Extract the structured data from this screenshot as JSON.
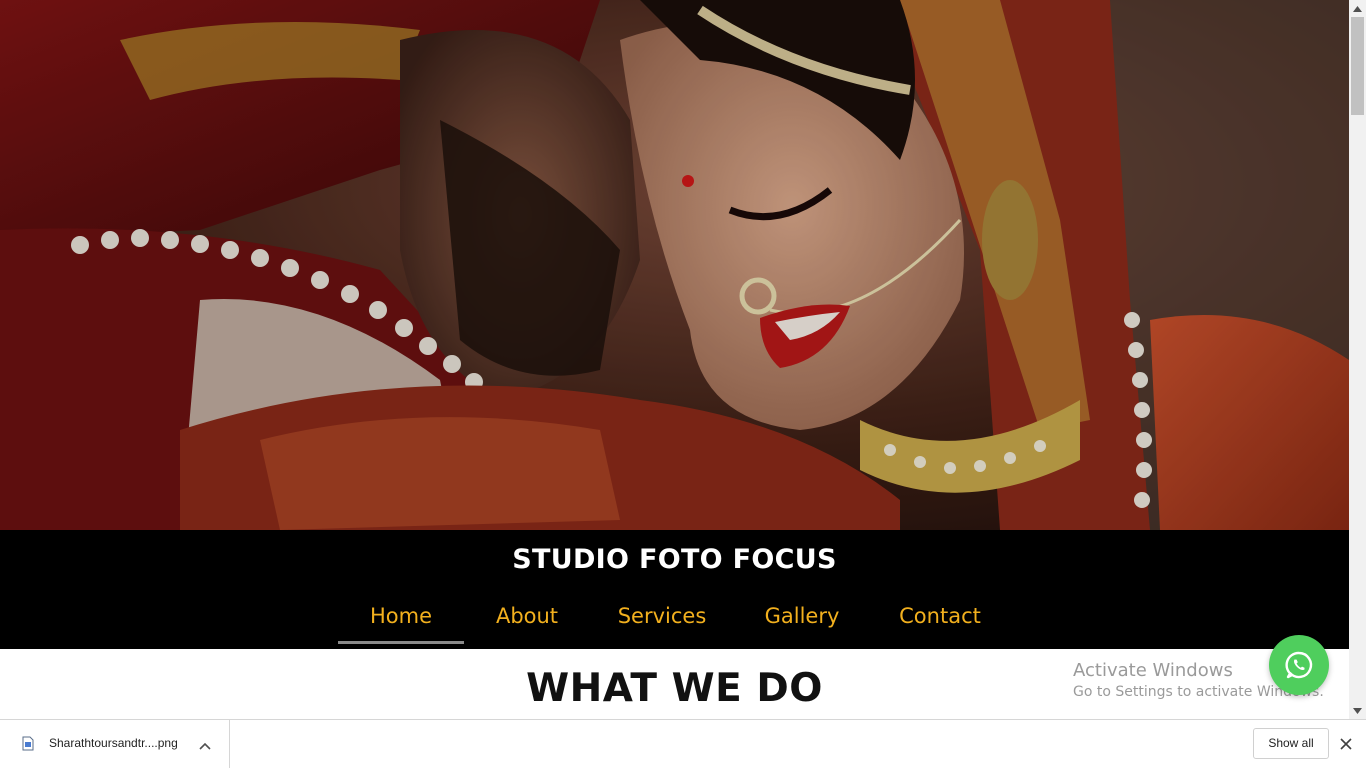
{
  "hero": {
    "image_description_icon": "wedding-couple-photo"
  },
  "header": {
    "brand": "STUDIO FOTO FOCUS",
    "nav": [
      {
        "label": "Home",
        "active": true
      },
      {
        "label": "About",
        "active": false
      },
      {
        "label": "Services",
        "active": false
      },
      {
        "label": "Gallery",
        "active": false
      },
      {
        "label": "Contact",
        "active": false
      }
    ]
  },
  "main": {
    "section_heading": "WHAT WE DO"
  },
  "watermark": {
    "line1": "Activate Windows",
    "line2": "Go to Settings to activate Windows."
  },
  "whatsapp": {
    "icon": "whatsapp-icon",
    "color": "#4fce5d"
  },
  "download_bar": {
    "filename": "Sharathtoursandtr....png",
    "show_all_label": "Show all"
  },
  "colors": {
    "nav_text": "#f2b01e",
    "brand_bar": "#000000",
    "brand_text": "#ffffff"
  }
}
